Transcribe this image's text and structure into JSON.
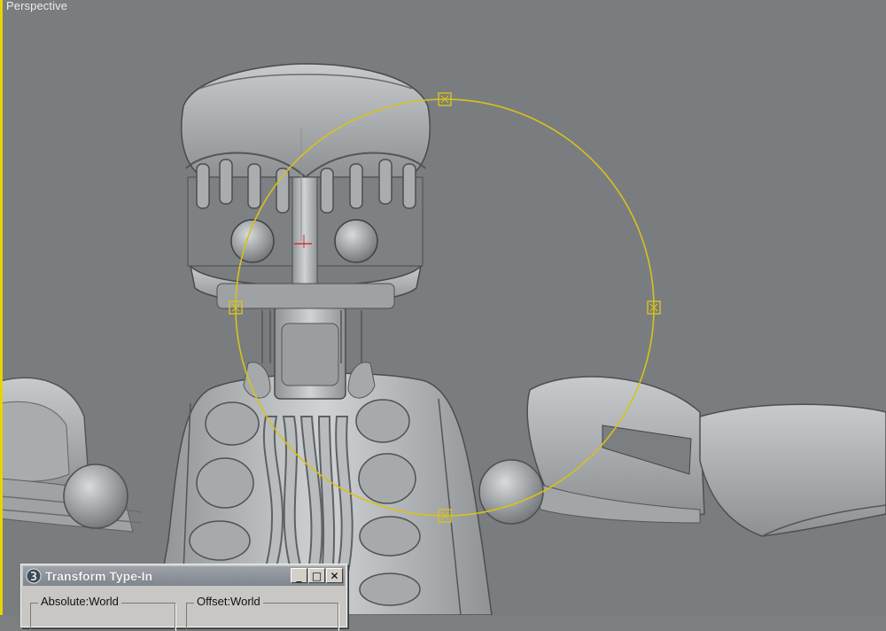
{
  "viewport": {
    "label": "Perspective",
    "border_color": "#e8d400",
    "background_color": "#7a7d7f"
  },
  "gizmo": {
    "type": "rotate-circle",
    "color": "#d8c21a",
    "handle_icon": "x-box-icon"
  },
  "model": {
    "description_icon": "robot-head-mesh"
  },
  "dialog": {
    "title": "Transform Type-In",
    "app_icon": "3dsmax-logo-icon",
    "minimize_label": "_",
    "maximize_label": "□",
    "close_label": "✕",
    "groups": [
      {
        "label": "Absolute:World"
      },
      {
        "label": "Offset:World"
      }
    ]
  }
}
